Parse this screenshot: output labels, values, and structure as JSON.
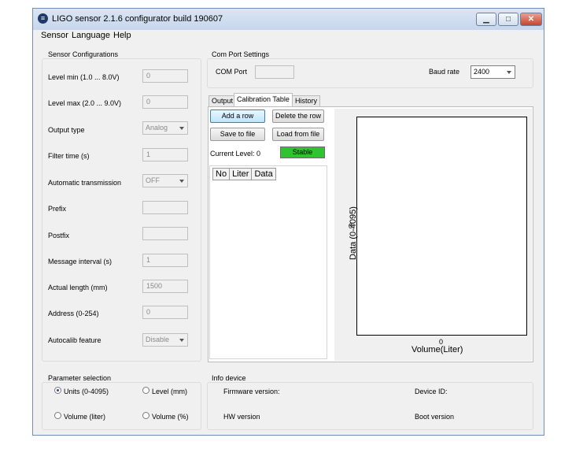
{
  "window": {
    "title": "LIGO sensor 2.1.6 configurator build 190607",
    "app_icon": "ligo-logo-icon"
  },
  "menu": [
    "Sensor",
    "Language",
    "Help"
  ],
  "sensor_config": {
    "title": "Sensor Configurations",
    "level_min_label": "Level min (1.0 ... 8.0V)",
    "level_min_value": "0",
    "level_max_label": "Level max (2.0 ... 9.0V)",
    "level_max_value": "0",
    "output_type_label": "Output type",
    "output_type_value": "Analog",
    "filter_time_label": "Filter time (s)",
    "filter_time_value": "1",
    "auto_transmission_label": "Automatic transmission",
    "auto_transmission_value": "OFF",
    "prefix_label": "Prefix",
    "prefix_value": "",
    "postfix_label": "Postfix",
    "postfix_value": "",
    "message_interval_label": "Message interval (s)",
    "message_interval_value": "1",
    "actual_length_label": "Actual length (mm)",
    "actual_length_value": "1500",
    "address_label": "Address (0-254)",
    "address_value": "0",
    "autocalib_label": "Autocalib feature",
    "autocalib_value": "Disable"
  },
  "com_port": {
    "title": "Com Port Settings",
    "port_label": "COM Port",
    "port_value": "",
    "baud_label": "Baud rate",
    "baud_value": "2400"
  },
  "tabs": [
    "Output",
    "Calibration Table",
    "History"
  ],
  "calibration": {
    "add_row": "Add a row",
    "delete_row": "Delete the row",
    "save_file": "Save to file",
    "load_file": "Load from file",
    "current_level_label": "Current Level:",
    "current_level_value": "0",
    "status": "Stable",
    "status_color": "#2fc42f",
    "columns": [
      "No",
      "Liter",
      "Data"
    ]
  },
  "chart_data": {
    "type": "line",
    "xlabel": "Volume(Liter)",
    "ylabel": "Data (0-4095)",
    "x_ticks": [
      "0"
    ],
    "y_ticks": [
      "0"
    ],
    "series": []
  },
  "parameter_selection": {
    "title": "Parameter selection",
    "options": [
      "Units (0-4095)",
      "Level (mm)",
      "Volume (liter)",
      "Volume (%)"
    ],
    "selected": "Units (0-4095)"
  },
  "info_device": {
    "title": "Info device",
    "firmware_label": "Firmware version:",
    "firmware_value": "",
    "device_id_label": "Device ID:",
    "device_id_value": "",
    "hw_label": "HW version",
    "hw_value": "",
    "boot_label": "Boot version",
    "boot_value": ""
  }
}
